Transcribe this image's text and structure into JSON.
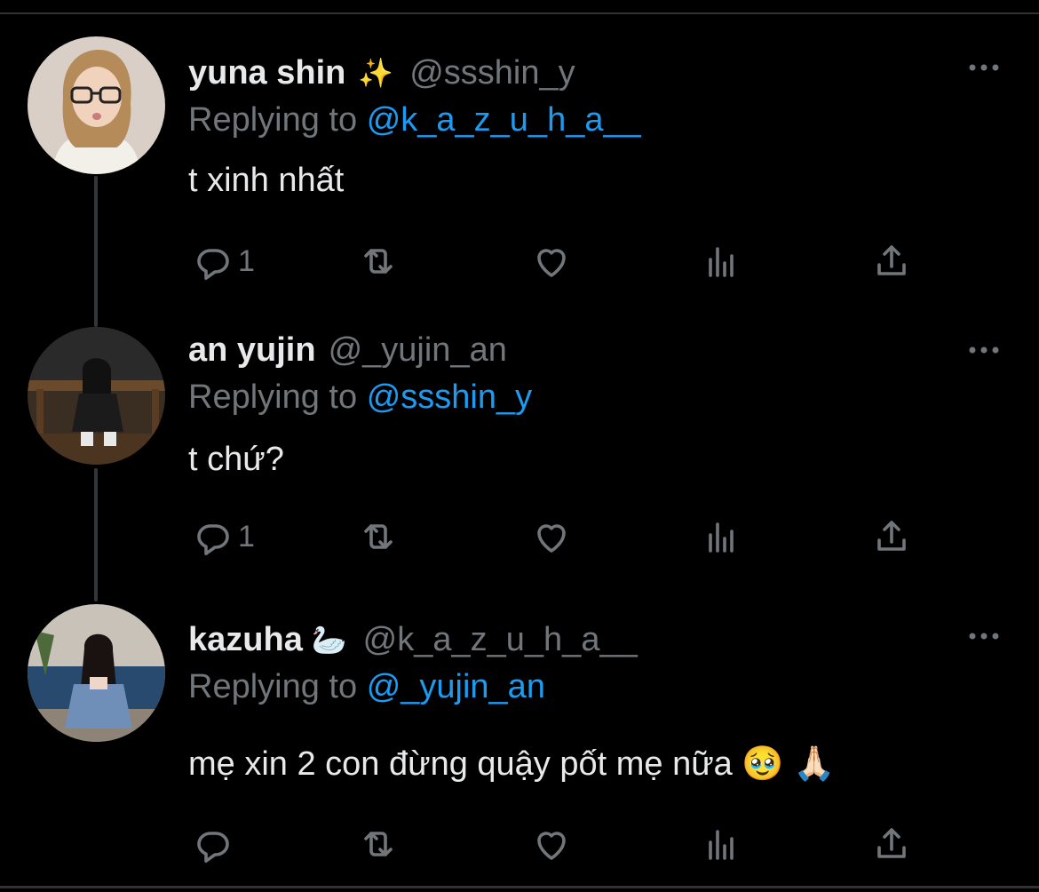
{
  "tweets": [
    {
      "name": "yuna shin",
      "name_emoji": "✨",
      "handle": "@ssshin_y",
      "replying_prefix": "Replying to",
      "replying_to": "@k_a_z_u_h_a__",
      "text": "t xinh nhất",
      "reply_count": "1"
    },
    {
      "name": "an yujin",
      "name_emoji": "",
      "handle": "@_yujin_an",
      "replying_prefix": "Replying to",
      "replying_to": "@ssshin_y",
      "text": "t chứ?",
      "reply_count": "1"
    },
    {
      "name": "kazuha",
      "name_emoji": "🦢",
      "handle": "@k_a_z_u_h_a__",
      "replying_prefix": "Replying to",
      "replying_to": "@_yujin_an",
      "text": "mẹ xin 2 con đừng quậy pốt mẹ nữa 🥹 🙏🏻",
      "reply_count": ""
    }
  ],
  "icons": {
    "reply": "reply-icon",
    "retweet": "retweet-icon",
    "like": "heart-icon",
    "views": "analytics-icon",
    "share": "share-icon",
    "more": "more-icon"
  },
  "colors": {
    "background": "#000000",
    "text": "#e7e9ea",
    "muted": "#71767b",
    "mention": "#1d9bf0",
    "divider": "#2f3336"
  }
}
